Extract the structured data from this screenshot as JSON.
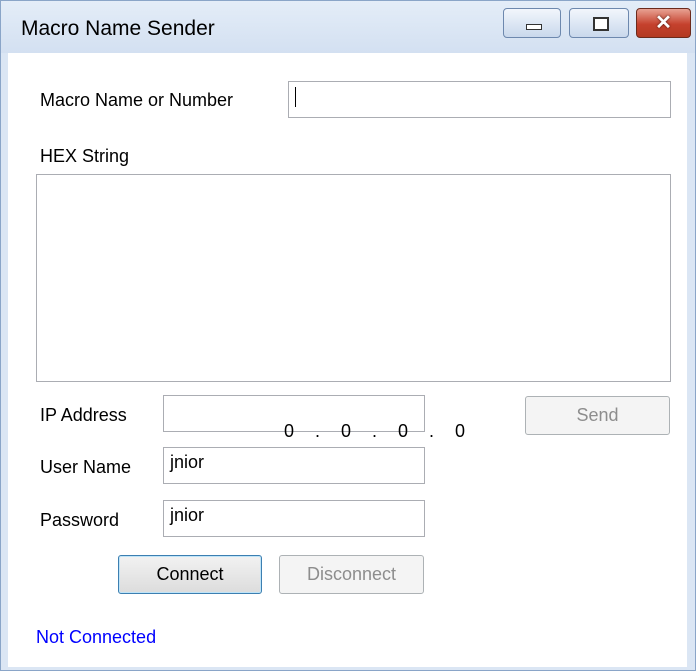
{
  "window": {
    "title": "Macro Name Sender",
    "close_glyph": "✕"
  },
  "form": {
    "macro_label": "Macro Name or Number",
    "macro_value": "",
    "hex_label": "HEX String",
    "hex_value": "",
    "ip_label": "IP Address",
    "ip_value": "0 . 0 . 0 . 0",
    "user_label": "User Name",
    "user_value": "jnior",
    "password_label": "Password",
    "password_value": "jnior"
  },
  "buttons": {
    "send": "Send",
    "connect": "Connect",
    "disconnect": "Disconnect"
  },
  "status": {
    "text": "Not Connected",
    "color": "#0000ff"
  },
  "icons": [
    "minimize-icon",
    "maximize-icon",
    "close-icon"
  ]
}
